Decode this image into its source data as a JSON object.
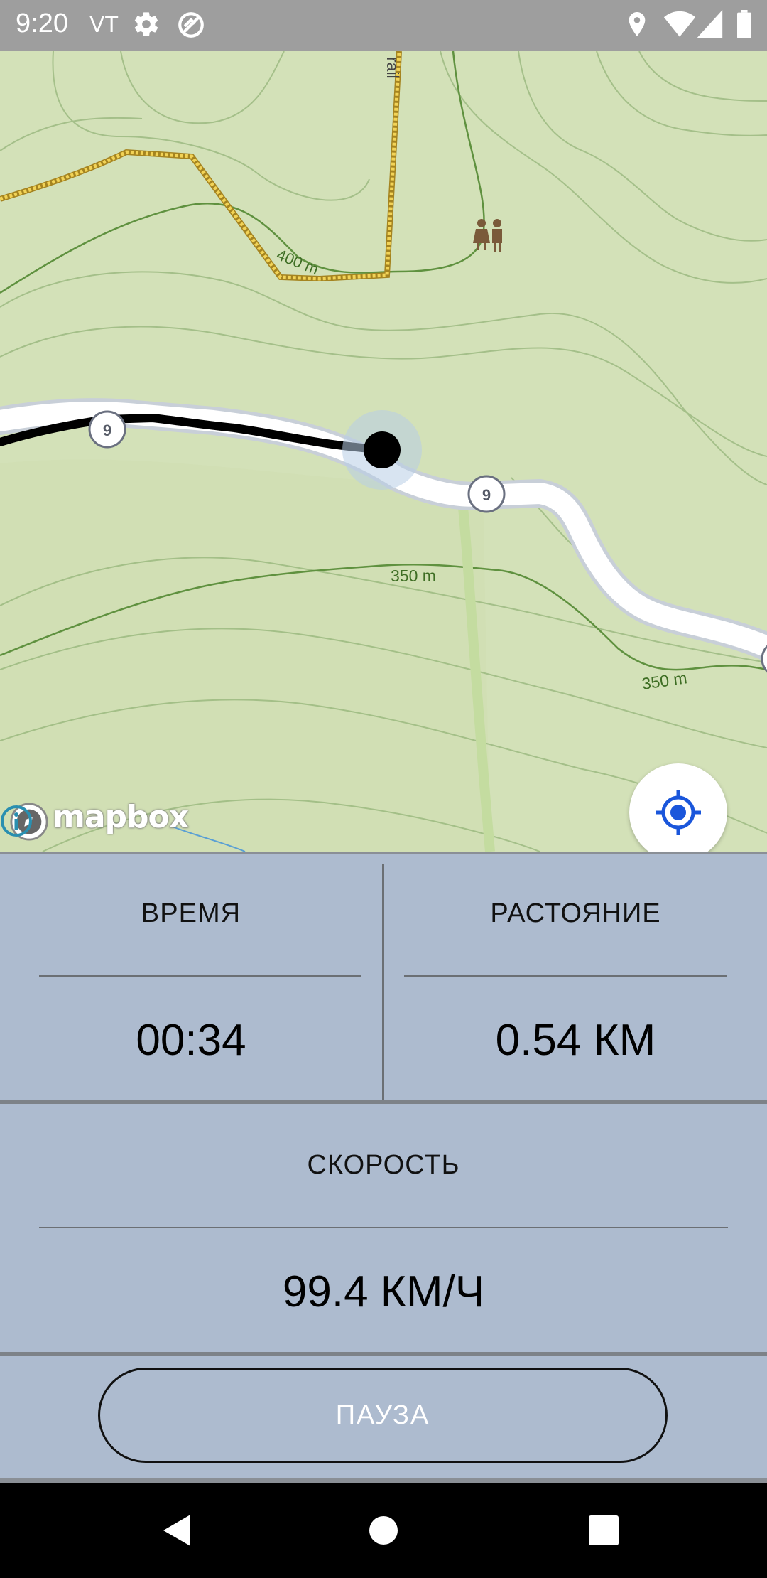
{
  "status_bar": {
    "time": "9:20",
    "carrier": "VT",
    "icons": [
      "settings-icon",
      "sync-off-icon",
      "location-icon",
      "wifi-icon",
      "signal-icon",
      "battery-icon"
    ]
  },
  "map": {
    "labels": {
      "trail": "rail",
      "contour_400": "400 m",
      "contour_350_a": "350 m",
      "contour_350_b": "350 m",
      "route_shield": "9",
      "route_shield_2": "9"
    },
    "attribution": "mapbox",
    "colors": {
      "land": "#d3e1b8",
      "contour": "#6a9a4a",
      "trail": "#e8c43c",
      "road": "#ffffff",
      "track": "#000000",
      "locate_accent": "#1a56db"
    }
  },
  "stats": {
    "time_label": "ВРЕМЯ",
    "time_value": "00:34",
    "distance_label": "РАСТОЯНИЕ",
    "distance_value": "0.54 КМ",
    "speed_label": "СКОРОСТЬ",
    "speed_value": "99.4 КМ/Ч"
  },
  "pause_button": {
    "label": "ПАУЗА"
  },
  "nav_bar": {
    "buttons": [
      "back-icon",
      "home-icon",
      "recents-icon"
    ]
  }
}
